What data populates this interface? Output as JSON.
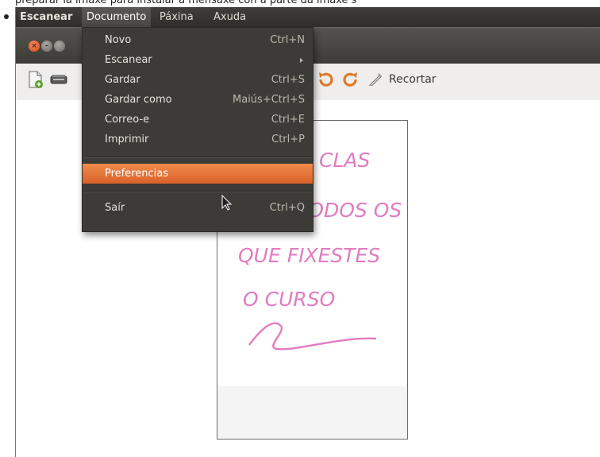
{
  "top_caption": "preparar la imaxe para instalar a mensaxe con a parte da imaxe s",
  "menubar": {
    "app_label": "Escanear",
    "items": [
      "Documento",
      "Páxina",
      "Axuda"
    ]
  },
  "toolbar": {
    "crop_label": "Recortar"
  },
  "document_menu": {
    "items": [
      {
        "label": "Novo",
        "accel": "Ctrl+N"
      },
      {
        "label": "Escanear",
        "accel": ""
      },
      {
        "label": "Gardar",
        "accel": "Ctrl+S"
      },
      {
        "label": "Gardar como",
        "accel": "Maiús+Ctrl+S"
      },
      {
        "label": "Correo-e",
        "accel": "Ctrl+E"
      },
      {
        "label": "Imprimir",
        "accel": "Ctrl+P"
      },
      {
        "label": "Preferencias",
        "accel": "",
        "highlighted": true
      },
      {
        "label": "Saír",
        "accel": "Ctrl+Q"
      }
    ]
  },
  "scanned_page": {
    "handwriting_lines": [
      "CLAS",
      "TODOS OS",
      "QUE FIXESTES",
      "O CURSO"
    ]
  },
  "colors": {
    "accent": "#E9722F",
    "panel": "#3C3B37",
    "ink": "#E066B0"
  }
}
